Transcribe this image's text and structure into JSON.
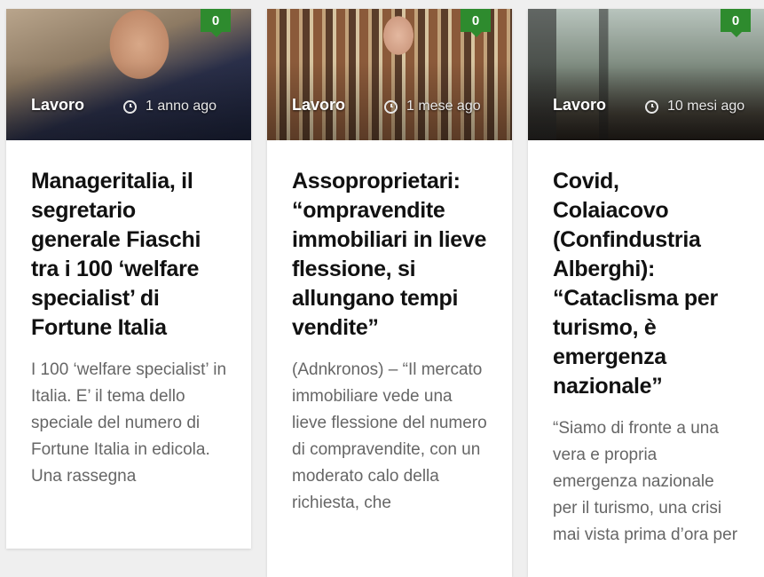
{
  "cards": [
    {
      "category": "Lavoro",
      "time": "1 anno ago",
      "comments": "0",
      "title": "Manageritalia, il segretario generale Fiaschi tra i 100 ‘welfare specialist’ di Fortune Italia",
      "excerpt": "I 100 ‘welfare specialist’ in Italia. E’ il tema dello speciale del numero di Fortune Italia in edicola. Una rassegna"
    },
    {
      "category": "Lavoro",
      "time": "1 mese ago",
      "comments": "0",
      "title": "Assoproprietari: “ompravendite immobiliari in lieve flessione, si allungano tempi vendite”",
      "excerpt": "(Adnkronos) – “Il mercato immobiliare vede una lieve flessione del numero di compravendite, con un moderato calo della richiesta, che"
    },
    {
      "category": "Lavoro",
      "time": "10 mesi ago",
      "comments": "0",
      "title": "Covid, Colaiacovo (Confindustria Alberghi): “Cataclisma per turismo, è emergenza nazionale”",
      "excerpt": "“Siamo di fronte a una vera e propria emergenza nazionale per il turismo, una crisi mai vista prima d’ora per"
    }
  ],
  "colors": {
    "badge": "#2e8b2e",
    "title": "#111111",
    "excerpt": "#666666"
  }
}
